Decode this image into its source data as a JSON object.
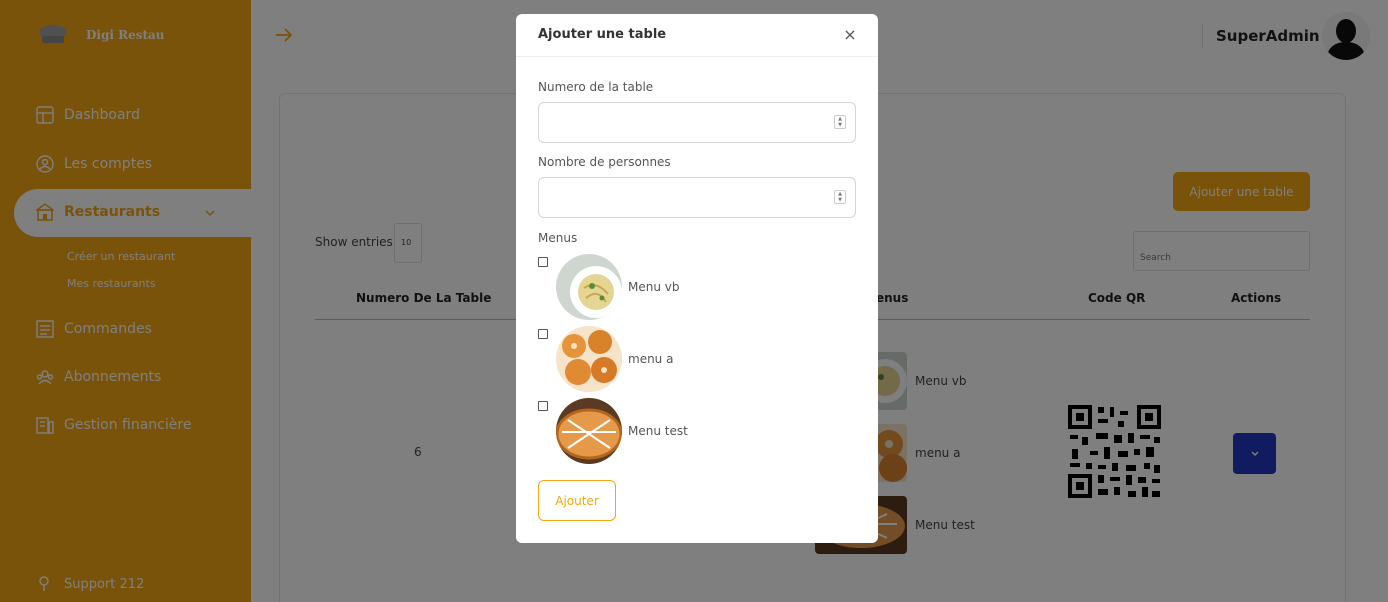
{
  "app": {
    "name": "Digi Restau"
  },
  "sidebar": {
    "items": [
      {
        "label": "Dashboard",
        "icon": "dashboard-icon"
      },
      {
        "label": "Les comptes",
        "icon": "accounts-icon"
      },
      {
        "label": "Restaurants",
        "icon": "restaurant-icon",
        "active": true
      },
      {
        "label": "Commandes",
        "icon": "orders-icon"
      },
      {
        "label": "Abonnements",
        "icon": "subscriptions-icon"
      },
      {
        "label": "Gestion financière",
        "icon": "finance-icon"
      }
    ],
    "subitems": [
      "Créer un restaurant",
      "Mes restaurants"
    ],
    "support": "Support 212"
  },
  "header": {
    "username": "SuperAdmin"
  },
  "page": {
    "add_button": "Ajouter une table",
    "show_entries_label": "Show entries",
    "entries_value": "10",
    "search_placeholder": "Search",
    "columns": [
      "Numero De La Table",
      "enus",
      "Code QR",
      "Actions"
    ],
    "rows": [
      {
        "number": "6",
        "menus": [
          "Menu vb",
          "menu a",
          "Menu test"
        ]
      }
    ]
  },
  "modal": {
    "title": "Ajouter une table",
    "close": "×",
    "table_number_label": "Numero de la table",
    "table_number_value": "",
    "persons_label": "Nombre de personnes",
    "persons_value": "",
    "menus_label": "Menus",
    "menus": [
      {
        "name": "Menu vb",
        "checked": false
      },
      {
        "name": "menu a",
        "checked": false
      },
      {
        "name": "Menu test",
        "checked": false
      }
    ],
    "submit": "Ajouter"
  },
  "colors": {
    "accent": "#f3a712",
    "action": "#2338c0",
    "overlay": "rgba(0,0,0,0.5)"
  }
}
